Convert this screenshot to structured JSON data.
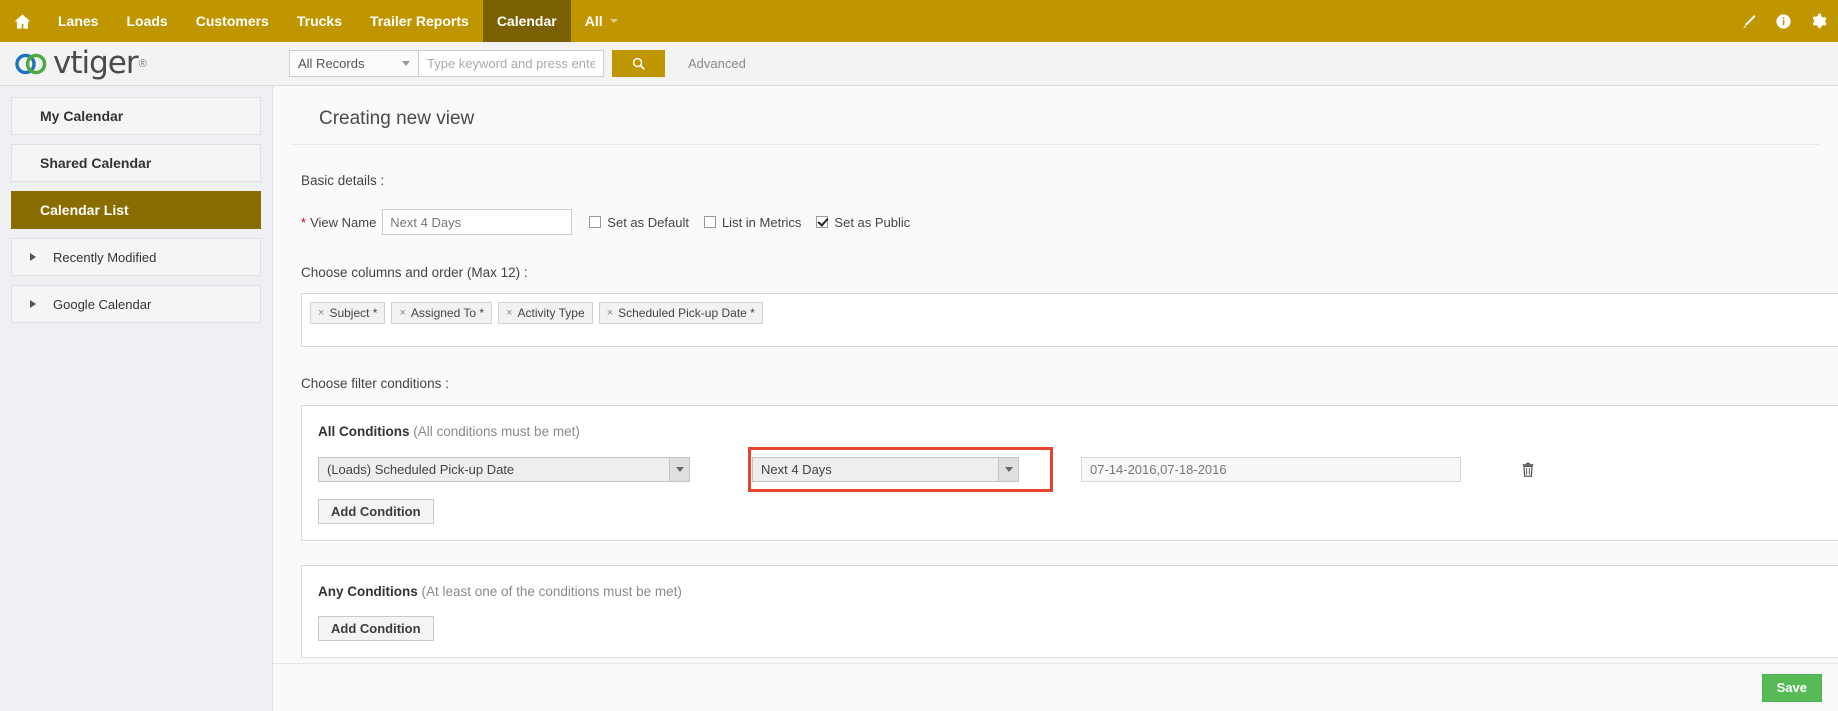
{
  "topnav": {
    "home_icon": "home-icon",
    "items": [
      {
        "label": "Lanes",
        "active": false
      },
      {
        "label": "Loads",
        "active": false
      },
      {
        "label": "Customers",
        "active": false
      },
      {
        "label": "Trucks",
        "active": false
      },
      {
        "label": "Trailer Reports",
        "active": false
      },
      {
        "label": "Calendar",
        "active": true
      },
      {
        "label": "All",
        "active": false,
        "caret": true
      }
    ],
    "right_icons": [
      "brush-icon",
      "info-icon",
      "gear-icon"
    ],
    "bg_color": "#bf9600",
    "active_bg_color": "#7a6000"
  },
  "search": {
    "logo_text": "vtiger",
    "logo_reg": "®",
    "scope_value": "All Records",
    "input_value": "",
    "placeholder": "Type keyword and press enter",
    "search_icon": "search-icon",
    "advanced_label": "Advanced"
  },
  "sidebar": {
    "items": [
      {
        "label": "My Calendar",
        "type": "item",
        "active": false
      },
      {
        "label": "Shared Calendar",
        "type": "item",
        "active": false
      },
      {
        "label": "Calendar List",
        "type": "item",
        "active": true
      },
      {
        "label": "Recently Modified",
        "type": "group",
        "active": false
      },
      {
        "label": "Google Calendar",
        "type": "group",
        "active": false
      }
    ]
  },
  "main": {
    "page_title": "Creating new view",
    "basic_details_label": "Basic details :",
    "view_name": {
      "required_mark": "*",
      "label": "View Name",
      "value": "Next 4 Days",
      "placeholder": ""
    },
    "checkboxes": [
      {
        "label": "Set as Default",
        "checked": false
      },
      {
        "label": "List in Metrics",
        "checked": false
      },
      {
        "label": "Set as Public",
        "checked": true
      }
    ],
    "columns_label": "Choose columns and order (Max 12) :",
    "column_tags": [
      {
        "label": "Subject *",
        "remove": "×"
      },
      {
        "label": "Assigned To *",
        "remove": "×"
      },
      {
        "label": "Activity Type",
        "remove": "×"
      },
      {
        "label": "Scheduled Pick-up Date *",
        "remove": "×"
      }
    ],
    "filters_label": "Choose filter conditions :",
    "all_conditions": {
      "title": "All Conditions",
      "subtitle": "(All conditions must be met)",
      "rows": [
        {
          "field": "(Loads) Scheduled Pick-up Date",
          "comparator": "Next 4 Days",
          "value": "07-14-2016,07-18-2016",
          "delete_icon": "trash-icon"
        }
      ],
      "add_condition_label": "Add Condition"
    },
    "any_conditions": {
      "title": "Any Conditions",
      "subtitle": "(At least one of the conditions must be met)",
      "add_condition_label": "Add Condition"
    },
    "highlight_color": "#e8412c",
    "save_label": "Save",
    "save_color": "#58b957"
  }
}
